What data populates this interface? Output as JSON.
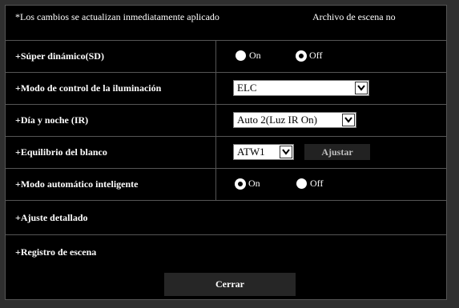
{
  "notice": {
    "left": "*Los cambios se actualizan inmediatamente aplicado",
    "right": "Archivo de escena no"
  },
  "rows": {
    "sd": {
      "label": "+Súper dinámico(SD)",
      "on": "On",
      "off": "Off",
      "selected": "Off"
    },
    "ilum": {
      "label": "+Modo de control de la iluminación",
      "value": "ELC"
    },
    "ir": {
      "label": "+Día y noche (IR)",
      "value": "Auto 2(Luz IR On)"
    },
    "wb": {
      "label": "+Equilibrio del blanco",
      "value": "ATW1",
      "button": "Ajustar"
    },
    "iauto": {
      "label": "+Modo automático inteligente",
      "on": "On",
      "off": "Off",
      "selected": "On"
    },
    "detalle": {
      "label": "+Ajuste detallado"
    },
    "registro": {
      "label": "+Registro de escena"
    }
  },
  "footer": {
    "close_label": "Cerrar"
  }
}
